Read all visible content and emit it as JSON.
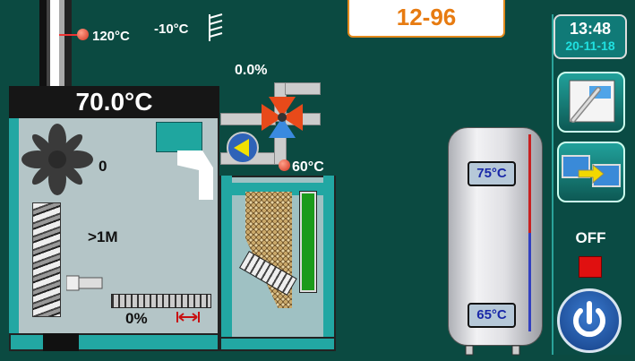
{
  "header": {
    "code": "12-96",
    "clock_time": "13:48",
    "clock_date": "20-11-18"
  },
  "chimney": {
    "flue_temp": "120°C",
    "outdoor_temp": "-10°C"
  },
  "boiler": {
    "temperature": "70.0°C",
    "fan_speed": "0",
    "auger_time": ">1M",
    "burner_power": "0%"
  },
  "mixing_valve": {
    "position": "0.0%",
    "return_temp": "60°C"
  },
  "tank": {
    "top_temp": "75°C",
    "bottom_temp": "65°C"
  },
  "side_panel": {
    "status_label": "OFF"
  },
  "colors": {
    "background": "#0b4a41",
    "accent_teal": "#22a7a3",
    "code_orange": "#e77b11",
    "status_red": "#e01010"
  },
  "icons": [
    "thermometer-settings-icon",
    "display-switch-icon",
    "power-icon",
    "snowflake-wind-icon",
    "fan-icon",
    "pump-icon",
    "mixing-valve-icon",
    "distance-arrows-icon"
  ]
}
